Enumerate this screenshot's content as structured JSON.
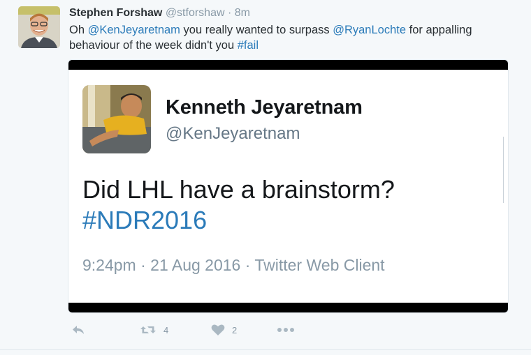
{
  "tweet": {
    "author_name": "Stephen Forshaw",
    "author_handle": "@stforshaw",
    "separator": "·",
    "time": "8m",
    "text_part1": "Oh ",
    "mention1": "@KenJeyaretnam",
    "text_part2": " you really wanted to surpass ",
    "mention2": "@RyanLochte",
    "text_part3": " for appalling behaviour of the week didn't you ",
    "hashtag": "#fail"
  },
  "quoted": {
    "name": "Kenneth Jeyaretnam",
    "handle": "@KenJeyaretnam",
    "text": "Did LHL have a brainstorm?",
    "hashtag": "#NDR2016",
    "meta": "9:24pm · 21 Aug 2016 · Twitter Web Client"
  },
  "actions": {
    "retweet_count": "4",
    "like_count": "2"
  },
  "icons": {
    "reply": "reply-icon",
    "retweet": "retweet-icon",
    "like": "heart-icon",
    "more": "more-icon"
  },
  "colors": {
    "link": "#2b7bb9",
    "muted": "#8899a6",
    "icon": "#aab8c2",
    "background": "#f5f8fa"
  }
}
